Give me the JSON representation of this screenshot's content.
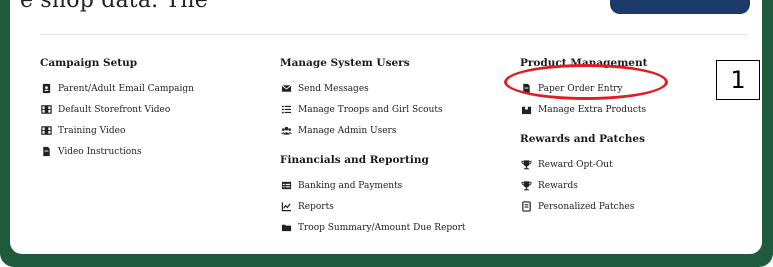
{
  "header": {
    "partial_text": "e shop data. The"
  },
  "columns": [
    {
      "sections": [
        {
          "title": "Campaign Setup",
          "items": [
            {
              "label": "Parent/Adult Email Campaign",
              "icon": "id-card-icon"
            },
            {
              "label": "Default Storefront Video",
              "icon": "film-icon"
            },
            {
              "label": "Training Video",
              "icon": "film-icon"
            },
            {
              "label": "Video Instructions",
              "icon": "file-icon"
            }
          ]
        }
      ]
    },
    {
      "sections": [
        {
          "title": "Manage System Users",
          "items": [
            {
              "label": "Send Messages",
              "icon": "envelope-icon"
            },
            {
              "label": "Manage Troops and Girl Scouts",
              "icon": "list-icon"
            },
            {
              "label": "Manage Admin Users",
              "icon": "users-icon"
            }
          ]
        },
        {
          "title": "Financials and Reporting",
          "items": [
            {
              "label": "Banking and Payments",
              "icon": "table-icon"
            },
            {
              "label": "Reports",
              "icon": "chart-icon"
            },
            {
              "label": "Troop Summary/Amount Due Report",
              "icon": "folder-icon"
            }
          ]
        }
      ]
    },
    {
      "sections": [
        {
          "title": "Product Management",
          "items": [
            {
              "label": "Paper Order Entry",
              "icon": "file-icon"
            },
            {
              "label": "Manage Extra Products",
              "icon": "box-icon"
            }
          ]
        },
        {
          "title": "Rewards and Patches",
          "items": [
            {
              "label": "Reward Opt-Out",
              "icon": "trophy-icon"
            },
            {
              "label": "Rewards",
              "icon": "trophy-icon"
            },
            {
              "label": "Personalized Patches",
              "icon": "badge-icon"
            }
          ]
        }
      ]
    }
  ],
  "annotation": {
    "label": "1",
    "highlight_color": "#e11d24"
  },
  "colors": {
    "frame": "#1f5a3c",
    "button": "#1d3b6a"
  }
}
